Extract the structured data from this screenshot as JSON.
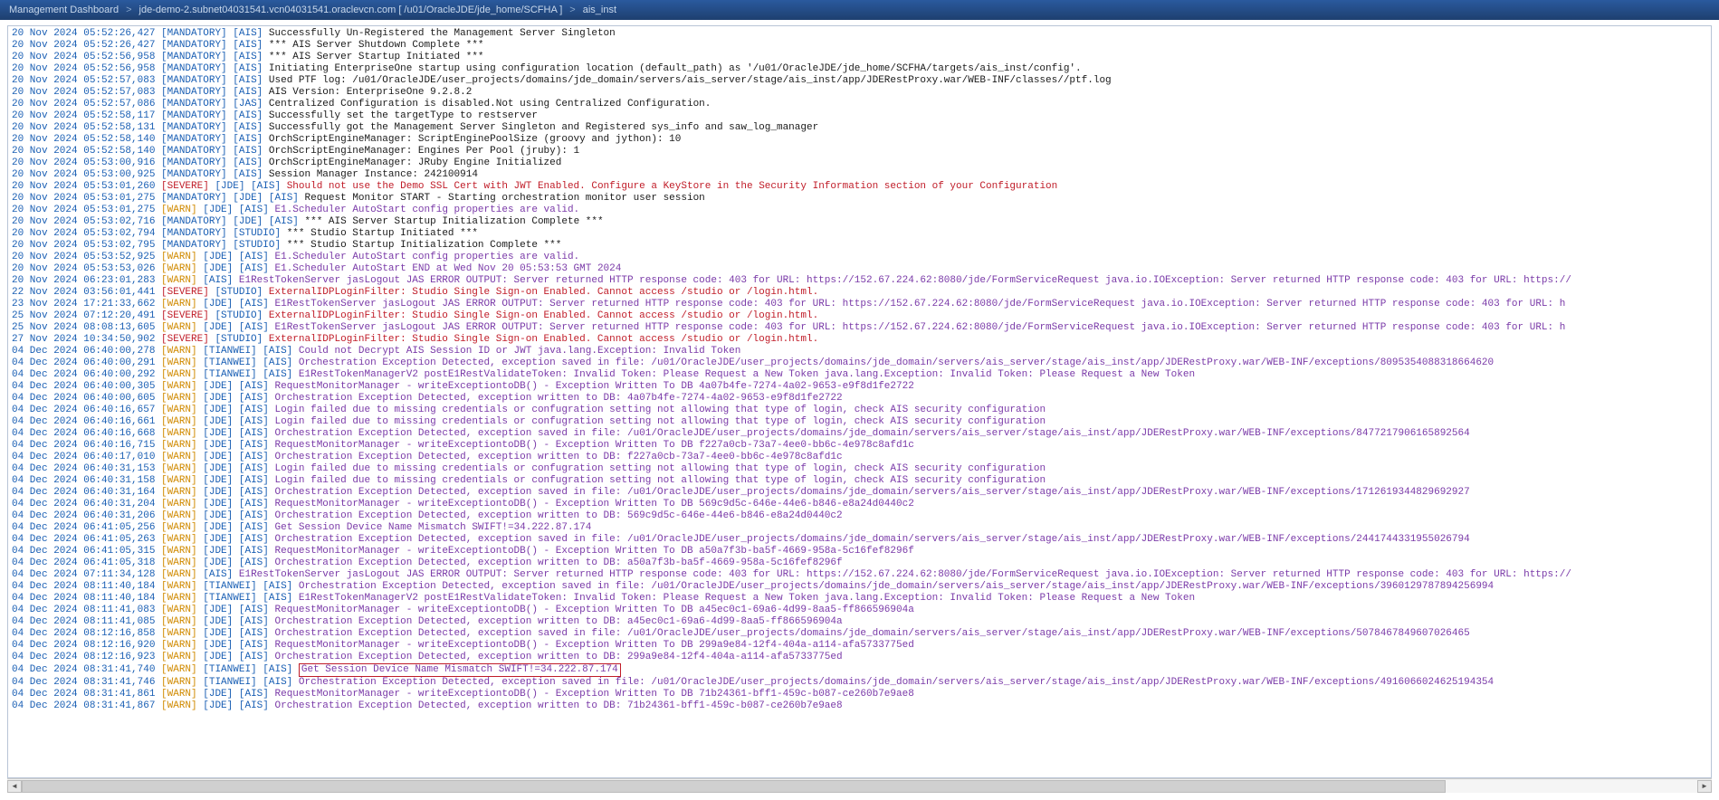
{
  "breadcrumb": {
    "item1": "Management Dashboard",
    "item2": "jde-demo-2.subnet04031541.vcn04031541.oraclevcn.com [ /u01/OracleJDE/jde_home/SCFHA ]",
    "item3": "ais_inst",
    "sep": ">"
  },
  "logs": [
    {
      "ts": "20 Nov 2024 05:52:26,427",
      "sev": "MANDATORY",
      "src": [
        "AIS"
      ],
      "msg": "Successfully Un-Registered the Management Server Singleton",
      "msgClass": "normal"
    },
    {
      "ts": "20 Nov 2024 05:52:26,427",
      "sev": "MANDATORY",
      "src": [
        "AIS"
      ],
      "msg": "*** AIS Server Shutdown Complete ***",
      "msgClass": "normal"
    },
    {
      "ts": "20 Nov 2024 05:52:56,958",
      "sev": "MANDATORY",
      "src": [
        "AIS"
      ],
      "msg": "*** AIS Server Startup Initiated ***",
      "msgClass": "normal"
    },
    {
      "ts": "20 Nov 2024 05:52:56,958",
      "sev": "MANDATORY",
      "src": [
        "AIS"
      ],
      "msg": "Initiating EnterpriseOne startup using configuration location (default_path) as '/u01/OracleJDE/jde_home/SCFHA/targets/ais_inst/config'.",
      "msgClass": "normal"
    },
    {
      "ts": "20 Nov 2024 05:52:57,083",
      "sev": "MANDATORY",
      "src": [
        "AIS"
      ],
      "msg": "Used PTF log: /u01/OracleJDE/user_projects/domains/jde_domain/servers/ais_server/stage/ais_inst/app/JDERestProxy.war/WEB-INF/classes//ptf.log",
      "msgClass": "normal"
    },
    {
      "ts": "20 Nov 2024 05:52:57,083",
      "sev": "MANDATORY",
      "src": [
        "AIS"
      ],
      "msg": "AIS Version: EnterpriseOne 9.2.8.2",
      "msgClass": "normal"
    },
    {
      "ts": "20 Nov 2024 05:52:57,086",
      "sev": "MANDATORY",
      "src": [
        "JAS"
      ],
      "msg": "Centralized Configuration is disabled.Not using Centralized Configuration.",
      "msgClass": "normal"
    },
    {
      "ts": "20 Nov 2024 05:52:58,117",
      "sev": "MANDATORY",
      "src": [
        "AIS"
      ],
      "msg": "Successfully set the targetType to restserver",
      "msgClass": "normal"
    },
    {
      "ts": "20 Nov 2024 05:52:58,131",
      "sev": "MANDATORY",
      "src": [
        "AIS"
      ],
      "msg": "Successfully got the Management Server Singleton and Registered sys_info and saw_log_manager",
      "msgClass": "normal"
    },
    {
      "ts": "20 Nov 2024 05:52:58,140",
      "sev": "MANDATORY",
      "src": [
        "AIS"
      ],
      "msg": "OrchScriptEngineManager: ScriptEnginePoolSize (groovy and jython): 10",
      "msgClass": "normal"
    },
    {
      "ts": "20 Nov 2024 05:52:58,140",
      "sev": "MANDATORY",
      "src": [
        "AIS"
      ],
      "msg": "OrchScriptEngineManager: Engines Per Pool (jruby): 1",
      "msgClass": "normal"
    },
    {
      "ts": "20 Nov 2024 05:53:00,916",
      "sev": "MANDATORY",
      "src": [
        "AIS"
      ],
      "msg": "OrchScriptEngineManager: JRuby Engine Initialized",
      "msgClass": "normal"
    },
    {
      "ts": "20 Nov 2024 05:53:00,925",
      "sev": "MANDATORY",
      "src": [
        "AIS"
      ],
      "msg": "Session Manager Instance: 242100914",
      "msgClass": "normal"
    },
    {
      "ts": "20 Nov 2024 05:53:01,260",
      "sev": "SEVERE",
      "src": [
        "JDE",
        "AIS"
      ],
      "msg": "Should not use the Demo SSL Cert with JWT Enabled. Configure a KeyStore in the Security Information section of your Configuration",
      "msgClass": "red"
    },
    {
      "ts": "20 Nov 2024 05:53:01,275",
      "sev": "MANDATORY",
      "src": [
        "JDE",
        "AIS"
      ],
      "msg": "Request Monitor START - Starting orchestration monitor user session",
      "msgClass": "normal"
    },
    {
      "ts": "20 Nov 2024 05:53:01,275",
      "sev": "WARN",
      "src": [
        "JDE",
        "AIS"
      ],
      "msg": "E1.Scheduler AutoStart config properties are valid.",
      "msgClass": "purple"
    },
    {
      "ts": "20 Nov 2024 05:53:02,716",
      "sev": "MANDATORY",
      "src": [
        "JDE",
        "AIS"
      ],
      "msg": "*** AIS Server Startup Initialization Complete ***",
      "msgClass": "normal"
    },
    {
      "ts": "20 Nov 2024 05:53:02,794",
      "sev": "MANDATORY",
      "src": [
        "STUDIO"
      ],
      "msg": "*** Studio Startup Initiated ***",
      "msgClass": "normal"
    },
    {
      "ts": "20 Nov 2024 05:53:02,795",
      "sev": "MANDATORY",
      "src": [
        "STUDIO"
      ],
      "msg": "*** Studio Startup Initialization Complete ***",
      "msgClass": "normal"
    },
    {
      "ts": "20 Nov 2024 05:53:52,925",
      "sev": "WARN",
      "src": [
        "JDE",
        "AIS"
      ],
      "msg": "E1.Scheduler AutoStart config properties are valid.",
      "msgClass": "purple"
    },
    {
      "ts": "20 Nov 2024 05:53:53,026",
      "sev": "WARN",
      "src": [
        "JDE",
        "AIS"
      ],
      "msg": "E1.Scheduler AutoStart END at Wed Nov 20 05:53:53 GMT 2024",
      "msgClass": "purple"
    },
    {
      "ts": "20 Nov 2024 06:23:01,283",
      "sev": "WARN",
      "src": [
        "AIS"
      ],
      "msg": "E1RestTokenServer jasLogout JAS ERROR OUTPUT: Server returned HTTP response code: 403 for URL: https://152.67.224.62:8080/jde/FormServiceRequest java.io.IOException: Server returned HTTP response code: 403 for URL: https://",
      "msgClass": "purple"
    },
    {
      "ts": "22 Nov 2024 03:56:01,441",
      "sev": "SEVERE",
      "src": [
        "STUDIO"
      ],
      "msg": "ExternalIDPLoginFilter: Studio Single Sign-on Enabled. Cannot access /studio or /login.html.",
      "msgClass": "red"
    },
    {
      "ts": "23 Nov 2024 17:21:33,662",
      "sev": "WARN",
      "src": [
        "JDE",
        "AIS"
      ],
      "msg": "E1RestTokenServer jasLogout JAS ERROR OUTPUT: Server returned HTTP response code: 403 for URL: https://152.67.224.62:8080/jde/FormServiceRequest java.io.IOException: Server returned HTTP response code: 403 for URL: h",
      "msgClass": "purple"
    },
    {
      "ts": "25 Nov 2024 07:12:20,491",
      "sev": "SEVERE",
      "src": [
        "STUDIO"
      ],
      "msg": "ExternalIDPLoginFilter: Studio Single Sign-on Enabled. Cannot access /studio or /login.html.",
      "msgClass": "red"
    },
    {
      "ts": "25 Nov 2024 08:08:13,605",
      "sev": "WARN",
      "src": [
        "JDE",
        "AIS"
      ],
      "msg": "E1RestTokenServer jasLogout JAS ERROR OUTPUT: Server returned HTTP response code: 403 for URL: https://152.67.224.62:8080/jde/FormServiceRequest java.io.IOException: Server returned HTTP response code: 403 for URL: h",
      "msgClass": "purple"
    },
    {
      "ts": "27 Nov 2024 10:34:50,902",
      "sev": "SEVERE",
      "src": [
        "STUDIO"
      ],
      "msg": "ExternalIDPLoginFilter: Studio Single Sign-on Enabled. Cannot access /studio or /login.html.",
      "msgClass": "red"
    },
    {
      "ts": "04 Dec 2024 06:40:00,278",
      "sev": "WARN",
      "src": [
        "TIANWEI",
        "AIS"
      ],
      "msg": "Could not Decrypt AIS Session ID or JWT java.lang.Exception: Invalid Token",
      "msgClass": "purple"
    },
    {
      "ts": "04 Dec 2024 06:40:00,291",
      "sev": "WARN",
      "src": [
        "TIANWEI",
        "AIS"
      ],
      "msg": "Orchestration Exception Detected, exception saved in file: /u01/OracleJDE/user_projects/domains/jde_domain/servers/ais_server/stage/ais_inst/app/JDERestProxy.war/WEB-INF/exceptions/8095354088318664620",
      "msgClass": "purple"
    },
    {
      "ts": "04 Dec 2024 06:40:00,292",
      "sev": "WARN",
      "src": [
        "TIANWEI",
        "AIS"
      ],
      "msg": "E1RestTokenManagerV2 postE1RestValidateToken: Invalid Token: Please Request a New Token java.lang.Exception: Invalid Token: Please Request a New Token",
      "msgClass": "purple"
    },
    {
      "ts": "04 Dec 2024 06:40:00,305",
      "sev": "WARN",
      "src": [
        "JDE",
        "AIS"
      ],
      "msg": "RequestMonitorManager - writeExceptiontoDB() - Exception Written To DB 4a07b4fe-7274-4a02-9653-e9f8d1fe2722",
      "msgClass": "purple"
    },
    {
      "ts": "04 Dec 2024 06:40:00,605",
      "sev": "WARN",
      "src": [
        "JDE",
        "AIS"
      ],
      "msg": "Orchestration Exception Detected, exception written to DB: 4a07b4fe-7274-4a02-9653-e9f8d1fe2722",
      "msgClass": "purple"
    },
    {
      "ts": "04 Dec 2024 06:40:16,657",
      "sev": "WARN",
      "src": [
        "JDE",
        "AIS"
      ],
      "msg": "Login failed due to missing credentials or confugration setting not allowing that type of login, check AIS security configuration",
      "msgClass": "purple"
    },
    {
      "ts": "04 Dec 2024 06:40:16,661",
      "sev": "WARN",
      "src": [
        "JDE",
        "AIS"
      ],
      "msg": "Login failed due to missing credentials or confugration setting not allowing that type of login, check AIS security configuration",
      "msgClass": "purple"
    },
    {
      "ts": "04 Dec 2024 06:40:16,668",
      "sev": "WARN",
      "src": [
        "JDE",
        "AIS"
      ],
      "msg": "Orchestration Exception Detected, exception saved in file: /u01/OracleJDE/user_projects/domains/jde_domain/servers/ais_server/stage/ais_inst/app/JDERestProxy.war/WEB-INF/exceptions/8477217906165892564",
      "msgClass": "purple"
    },
    {
      "ts": "04 Dec 2024 06:40:16,715",
      "sev": "WARN",
      "src": [
        "JDE",
        "AIS"
      ],
      "msg": "RequestMonitorManager - writeExceptiontoDB() - Exception Written To DB f227a0cb-73a7-4ee0-bb6c-4e978c8afd1c",
      "msgClass": "purple"
    },
    {
      "ts": "04 Dec 2024 06:40:17,010",
      "sev": "WARN",
      "src": [
        "JDE",
        "AIS"
      ],
      "msg": "Orchestration Exception Detected, exception written to DB: f227a0cb-73a7-4ee0-bb6c-4e978c8afd1c",
      "msgClass": "purple"
    },
    {
      "ts": "04 Dec 2024 06:40:31,153",
      "sev": "WARN",
      "src": [
        "JDE",
        "AIS"
      ],
      "msg": "Login failed due to missing credentials or confugration setting not allowing that type of login, check AIS security configuration",
      "msgClass": "purple"
    },
    {
      "ts": "04 Dec 2024 06:40:31,158",
      "sev": "WARN",
      "src": [
        "JDE",
        "AIS"
      ],
      "msg": "Login failed due to missing credentials or confugration setting not allowing that type of login, check AIS security configuration",
      "msgClass": "purple"
    },
    {
      "ts": "04 Dec 2024 06:40:31,164",
      "sev": "WARN",
      "src": [
        "JDE",
        "AIS"
      ],
      "msg": "Orchestration Exception Detected, exception saved in file: /u01/OracleJDE/user_projects/domains/jde_domain/servers/ais_server/stage/ais_inst/app/JDERestProxy.war/WEB-INF/exceptions/1712619344829692927",
      "msgClass": "purple"
    },
    {
      "ts": "04 Dec 2024 06:40:31,204",
      "sev": "WARN",
      "src": [
        "JDE",
        "AIS"
      ],
      "msg": "RequestMonitorManager - writeExceptiontoDB() - Exception Written To DB 569c9d5c-646e-44e6-b846-e8a24d0440c2",
      "msgClass": "purple"
    },
    {
      "ts": "04 Dec 2024 06:40:31,206",
      "sev": "WARN",
      "src": [
        "JDE",
        "AIS"
      ],
      "msg": "Orchestration Exception Detected, exception written to DB: 569c9d5c-646e-44e6-b846-e8a24d0440c2",
      "msgClass": "purple"
    },
    {
      "ts": "04 Dec 2024 06:41:05,256",
      "sev": "WARN",
      "src": [
        "JDE",
        "AIS"
      ],
      "msg": "Get Session Device Name Mismatch SWIFT!=34.222.87.174",
      "msgClass": "purple"
    },
    {
      "ts": "04 Dec 2024 06:41:05,263",
      "sev": "WARN",
      "src": [
        "JDE",
        "AIS"
      ],
      "msg": "Orchestration Exception Detected, exception saved in file: /u01/OracleJDE/user_projects/domains/jde_domain/servers/ais_server/stage/ais_inst/app/JDERestProxy.war/WEB-INF/exceptions/2441744331955026794",
      "msgClass": "purple"
    },
    {
      "ts": "04 Dec 2024 06:41:05,315",
      "sev": "WARN",
      "src": [
        "JDE",
        "AIS"
      ],
      "msg": "RequestMonitorManager - writeExceptiontoDB() - Exception Written To DB a50a7f3b-ba5f-4669-958a-5c16fef8296f",
      "msgClass": "purple"
    },
    {
      "ts": "04 Dec 2024 06:41:05,318",
      "sev": "WARN",
      "src": [
        "JDE",
        "AIS"
      ],
      "msg": "Orchestration Exception Detected, exception written to DB: a50a7f3b-ba5f-4669-958a-5c16fef8296f",
      "msgClass": "purple"
    },
    {
      "ts": "04 Dec 2024 07:11:34,128",
      "sev": "WARN",
      "src": [
        "AIS"
      ],
      "msg": "E1RestTokenServer jasLogout JAS ERROR OUTPUT: Server returned HTTP response code: 403 for URL: https://152.67.224.62:8080/jde/FormServiceRequest java.io.IOException: Server returned HTTP response code: 403 for URL: https://",
      "msgClass": "purple"
    },
    {
      "ts": "04 Dec 2024 08:11:40,184",
      "sev": "WARN",
      "src": [
        "TIANWEI",
        "AIS"
      ],
      "msg": "Orchestration Exception Detected, exception saved in file: /u01/OracleJDE/user_projects/domains/jde_domain/servers/ais_server/stage/ais_inst/app/JDERestProxy.war/WEB-INF/exceptions/3960129787894256994",
      "msgClass": "purple"
    },
    {
      "ts": "04 Dec 2024 08:11:40,184",
      "sev": "WARN",
      "src": [
        "TIANWEI",
        "AIS"
      ],
      "msg": "E1RestTokenManagerV2 postE1RestValidateToken: Invalid Token: Please Request a New Token java.lang.Exception: Invalid Token: Please Request a New Token",
      "msgClass": "purple"
    },
    {
      "ts": "04 Dec 2024 08:11:41,083",
      "sev": "WARN",
      "src": [
        "JDE",
        "AIS"
      ],
      "msg": "RequestMonitorManager - writeExceptiontoDB() - Exception Written To DB a45ec0c1-69a6-4d99-8aa5-ff866596904a",
      "msgClass": "purple"
    },
    {
      "ts": "04 Dec 2024 08:11:41,085",
      "sev": "WARN",
      "src": [
        "JDE",
        "AIS"
      ],
      "msg": "Orchestration Exception Detected, exception written to DB: a45ec0c1-69a6-4d99-8aa5-ff866596904a",
      "msgClass": "purple"
    },
    {
      "ts": "04 Dec 2024 08:12:16,858",
      "sev": "WARN",
      "src": [
        "JDE",
        "AIS"
      ],
      "msg": "Orchestration Exception Detected, exception saved in file: /u01/OracleJDE/user_projects/domains/jde_domain/servers/ais_server/stage/ais_inst/app/JDERestProxy.war/WEB-INF/exceptions/5078467849607026465",
      "msgClass": "purple"
    },
    {
      "ts": "04 Dec 2024 08:12:16,920",
      "sev": "WARN",
      "src": [
        "JDE",
        "AIS"
      ],
      "msg": "RequestMonitorManager - writeExceptiontoDB() - Exception Written To DB 299a9e84-12f4-404a-a114-afa5733775ed",
      "msgClass": "purple"
    },
    {
      "ts": "04 Dec 2024 08:12:16,923",
      "sev": "WARN",
      "src": [
        "JDE",
        "AIS"
      ],
      "msg": "Orchestration Exception Detected, exception written to DB: 299a9e84-12f4-404a-a114-afa5733775ed",
      "msgClass": "purple"
    },
    {
      "ts": "04 Dec 2024 08:31:41,740",
      "sev": "WARN",
      "src": [
        "TIANWEI",
        "AIS"
      ],
      "msg": "Get Session Device Name Mismatch SWIFT!=34.222.87.174",
      "msgClass": "purple",
      "highlight": true
    },
    {
      "ts": "04 Dec 2024 08:31:41,746",
      "sev": "WARN",
      "src": [
        "TIANWEI",
        "AIS"
      ],
      "msg": "Orchestration Exception Detected, exception saved in file: /u01/OracleJDE/user_projects/domains/jde_domain/servers/ais_server/stage/ais_inst/app/JDERestProxy.war/WEB-INF/exceptions/4916066024625194354",
      "msgClass": "purple"
    },
    {
      "ts": "04 Dec 2024 08:31:41,861",
      "sev": "WARN",
      "src": [
        "JDE",
        "AIS"
      ],
      "msg": "RequestMonitorManager - writeExceptiontoDB() - Exception Written To DB 71b24361-bff1-459c-b087-ce260b7e9ae8",
      "msgClass": "purple"
    },
    {
      "ts": "04 Dec 2024 08:31:41,867",
      "sev": "WARN",
      "src": [
        "JDE",
        "AIS"
      ],
      "msg": "Orchestration Exception Detected, exception written to DB: 71b24361-bff1-459c-b087-ce260b7e9ae8",
      "msgClass": "purple"
    }
  ]
}
